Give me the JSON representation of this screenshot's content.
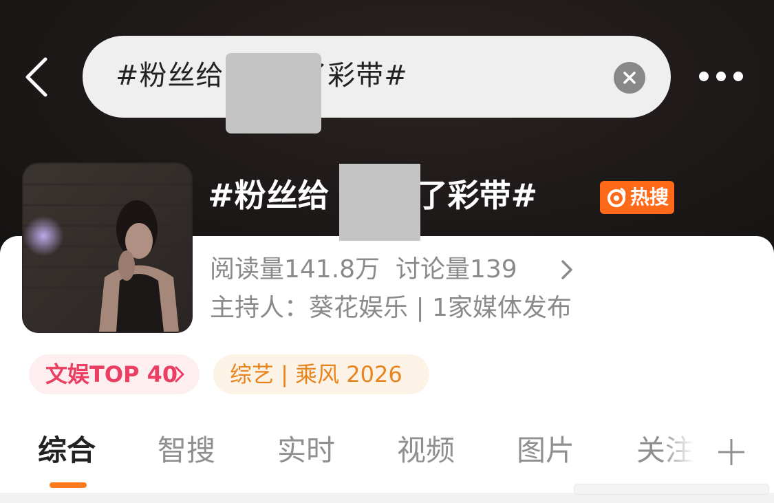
{
  "header": {
    "search_query": "#粉丝给        了彩带#",
    "back_icon": "chevron-left-icon",
    "clear_icon": "close-icon",
    "more_icon": "more-horizontal-icon"
  },
  "topic": {
    "title": "#粉丝给     喷了彩带#",
    "hot_badge": "热搜",
    "hot_icon": "fire-ring-icon",
    "stats_text": "阅读量141.8万  讨论量139",
    "host_text": "主持人：葵花娱乐 | 1家媒体发布"
  },
  "tags": {
    "entertainment": "文娱TOP 40",
    "variety": "综艺 | 乘风 2026"
  },
  "tabs": [
    {
      "label": "综合"
    },
    {
      "label": "智搜"
    },
    {
      "label": "实时"
    },
    {
      "label": "视频"
    },
    {
      "label": "图片"
    },
    {
      "label": "关注"
    }
  ],
  "colors": {
    "accent": "#ff7a1a",
    "hot_badge_bg": "#ff6a1a",
    "tag_pink": "#ea3f62",
    "tag_orange": "#e8841d"
  }
}
